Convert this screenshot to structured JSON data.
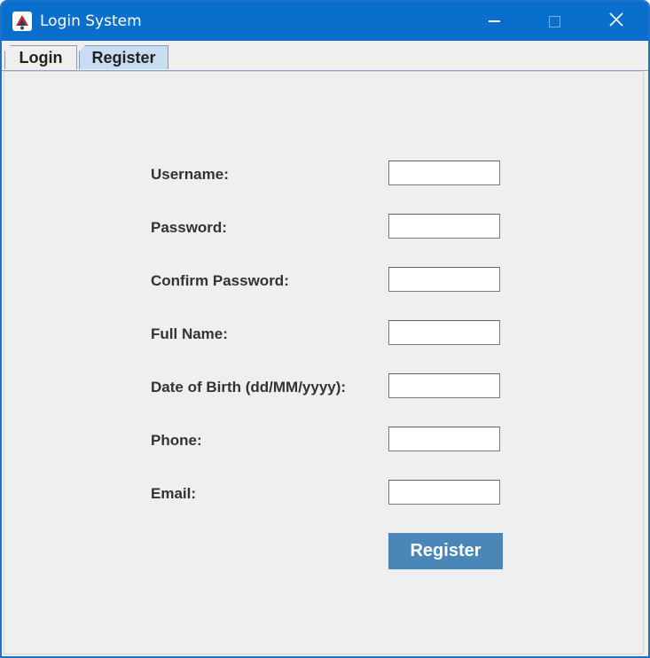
{
  "window": {
    "title": "Login System",
    "controls": {
      "minimize": "minimize",
      "maximize": "maximize",
      "close": "close"
    }
  },
  "tabs": [
    {
      "label": "Login",
      "selected": false
    },
    {
      "label": "Register",
      "selected": true
    }
  ],
  "register_form": {
    "fields": [
      {
        "label": "Username:",
        "value": ""
      },
      {
        "label": "Password:",
        "value": ""
      },
      {
        "label": "Confirm Password:",
        "value": ""
      },
      {
        "label": "Full Name:",
        "value": ""
      },
      {
        "label": "Date of Birth (dd/MM/yyyy):",
        "value": ""
      },
      {
        "label": "Phone:",
        "value": ""
      },
      {
        "label": "Email:",
        "value": ""
      }
    ],
    "submit_label": "Register"
  },
  "colors": {
    "titlebar": "#0a6fcc",
    "selected_tab": "#c8ddf2",
    "button": "#4a86b8",
    "background": "#efefef"
  },
  "icons": {
    "app": "java-app-icon",
    "minimize": "minimize-icon",
    "maximize": "maximize-icon",
    "close": "close-icon"
  }
}
